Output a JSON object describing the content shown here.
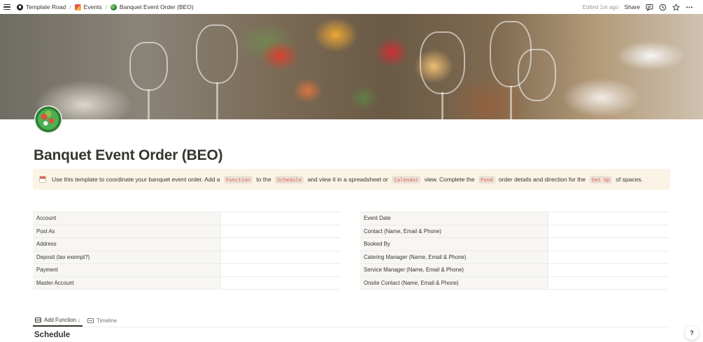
{
  "breadcrumb": [
    {
      "label": "Template Road",
      "icon": "template-road-icon"
    },
    {
      "label": "Events",
      "icon": "events-icon"
    },
    {
      "label": "Banquet Event Order (BEO)",
      "icon": "salad-icon"
    }
  ],
  "topbar": {
    "edited": "Edited 1m ago",
    "share": "Share",
    "icons": [
      "comments-icon",
      "updates-icon",
      "favorite-star-icon",
      "more-icon"
    ]
  },
  "page": {
    "title": "Banquet Event Order (BEO)",
    "icon": "salad-icon"
  },
  "callout": {
    "icon": "calendar-icon",
    "parts": [
      {
        "t": "text",
        "v": "Use this template to coordinate your banquet event order. Add a "
      },
      {
        "t": "code",
        "v": "Function"
      },
      {
        "t": "text",
        "v": " to the "
      },
      {
        "t": "code",
        "v": "Schedule"
      },
      {
        "t": "text",
        "v": " and view it in a spreadsheet or "
      },
      {
        "t": "code",
        "v": "Calendar"
      },
      {
        "t": "text",
        "v": " view. Complete the "
      },
      {
        "t": "code",
        "v": "Food"
      },
      {
        "t": "text",
        "v": " order details and direction for the "
      },
      {
        "t": "code",
        "v": "Set Up"
      },
      {
        "t": "text",
        "v": " of spaces."
      }
    ]
  },
  "left_table": [
    "Account",
    "Post As",
    "Address",
    "Deposit (tax exempt?)",
    "Payment",
    "Master Account"
  ],
  "right_table": [
    "Event Date",
    "Contact (Name, Email & Phone)",
    "Booked By",
    "Catering Manager (Name, Email & Phone)",
    "Service Manager (Name, Email & Phone)",
    "Onsite Contact (Name, Email & Phone)"
  ],
  "tabs": [
    {
      "label": "Add Function ↓",
      "icon": "table-icon",
      "active": true
    },
    {
      "label": "Timeline",
      "icon": "timeline-icon",
      "active": false
    }
  ],
  "section_title": "Schedule",
  "help": "?"
}
